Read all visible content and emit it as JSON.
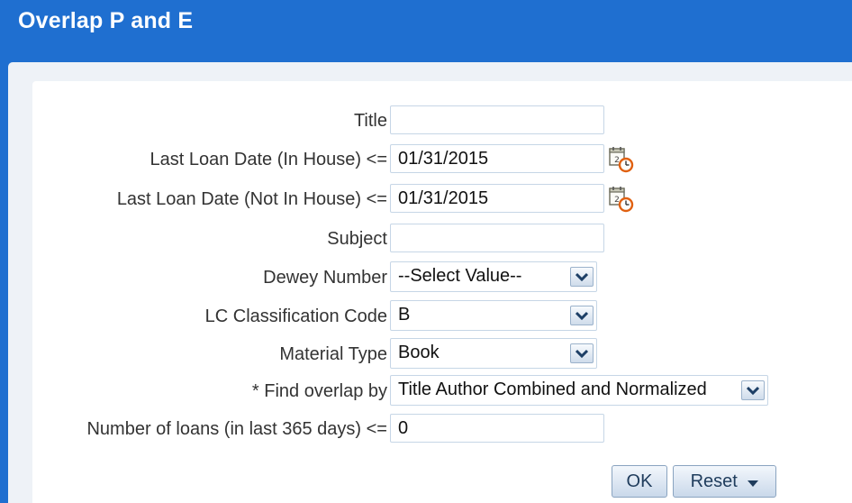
{
  "window": {
    "title": "Overlap P and E"
  },
  "form": {
    "title": {
      "label": "Title",
      "value": ""
    },
    "last_loan_in_house": {
      "label": "Last Loan Date (In House) <=",
      "value": "01/31/2015"
    },
    "last_loan_not_in_house": {
      "label": "Last Loan Date (Not In House) <=",
      "value": "01/31/2015"
    },
    "subject": {
      "label": "Subject",
      "value": ""
    },
    "dewey_number": {
      "label": "Dewey Number",
      "value": "--Select Value--"
    },
    "lc_classification": {
      "label": "LC Classification Code",
      "value": "B"
    },
    "material_type": {
      "label": "Material Type",
      "value": "Book"
    },
    "find_overlap_by": {
      "label": "* Find overlap by",
      "value": "Title Author Combined and Normalized"
    },
    "number_of_loans": {
      "label": "Number of loans (in last 365 days) <=",
      "value": "0"
    }
  },
  "buttons": {
    "ok": "OK",
    "reset": "Reset"
  },
  "icons": {
    "calendar": "calendar-clock-icon",
    "dropdown": "chevron-down-icon",
    "menu_caret": "caret-down-icon"
  },
  "colors": {
    "header_blue": "#1f6fd0",
    "input_border": "#c6d6e6",
    "button_text": "#1f3c5c"
  }
}
